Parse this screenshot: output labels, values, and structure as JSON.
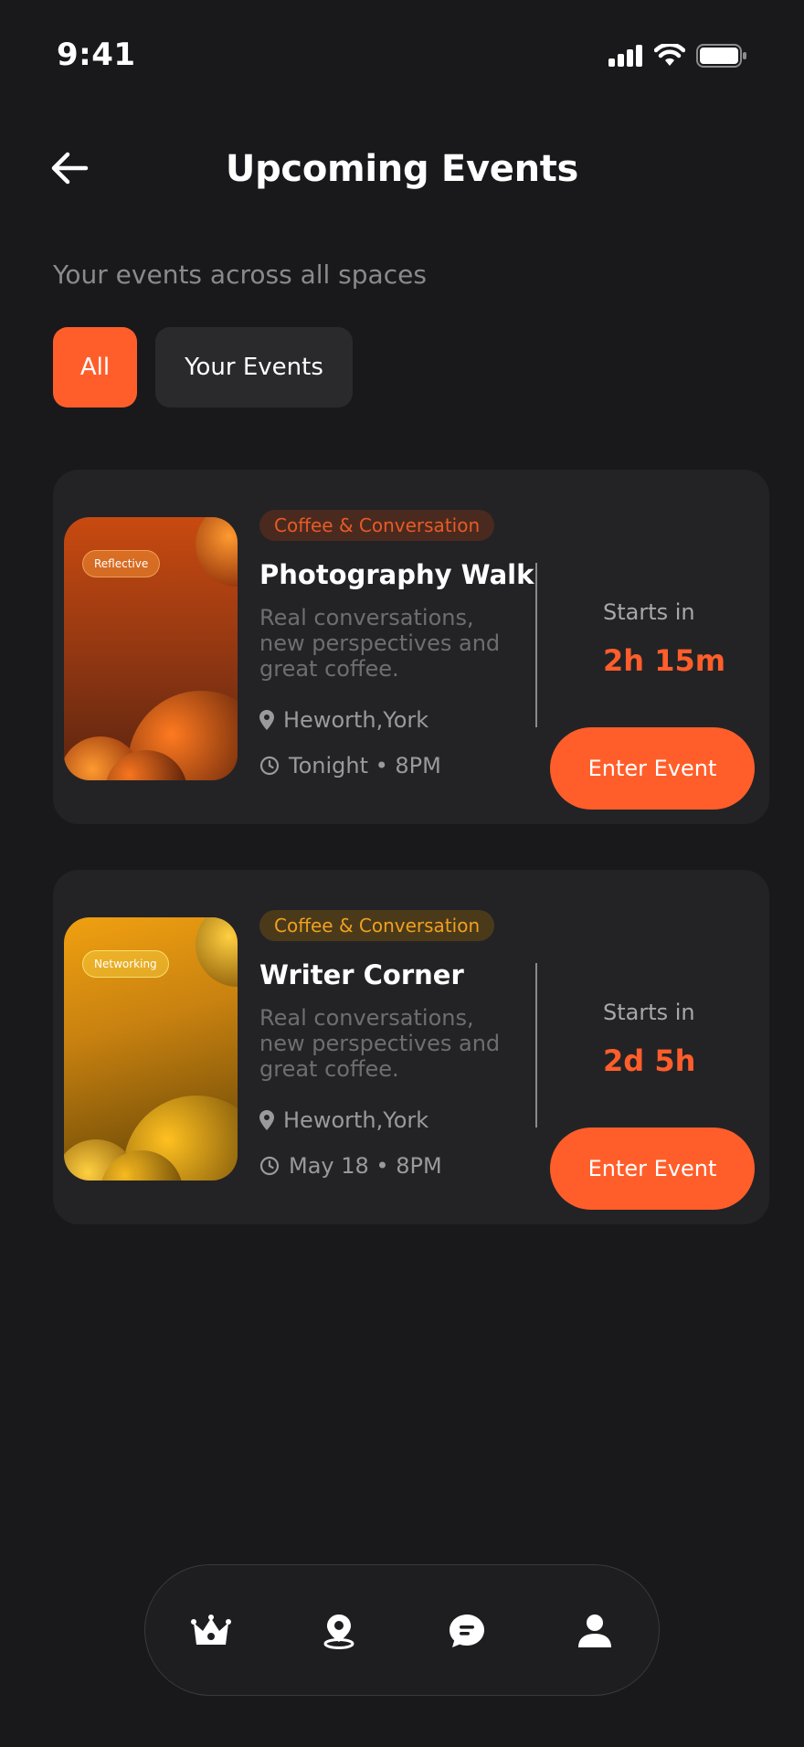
{
  "status_bar": {
    "time": "9:41"
  },
  "header": {
    "title": "Upcoming Events"
  },
  "subtitle": "Your events across all spaces",
  "filters": [
    {
      "label": "All",
      "active": true
    },
    {
      "label": "Your Events",
      "active": false
    }
  ],
  "events": [
    {
      "thumb_tag": "Reflective",
      "category": "Coffee & Conversation",
      "title": "Photography Walk",
      "description": "Real conversations, new perspectives and great coffee.",
      "location": "Heworth,York",
      "time": "Tonight • 8PM",
      "starts_label": "Starts in",
      "starts_value": "2h 15m",
      "button": "Enter Event"
    },
    {
      "thumb_tag": "Networking",
      "category": "Coffee & Conversation",
      "title": "Writer Corner",
      "description": "Real conversations, new perspectives and great coffee.",
      "location": "Heworth,York",
      "time": "May 18 • 8PM",
      "starts_label": "Starts in",
      "starts_value": "2d 5h",
      "button": "Enter Event"
    }
  ],
  "tabbar": {
    "icons": [
      "crown-icon",
      "map-pin-icon",
      "chat-icon",
      "profile-icon"
    ]
  },
  "colors": {
    "accent": "#ff5e2b",
    "background": "#19191b",
    "card": "#232326"
  }
}
